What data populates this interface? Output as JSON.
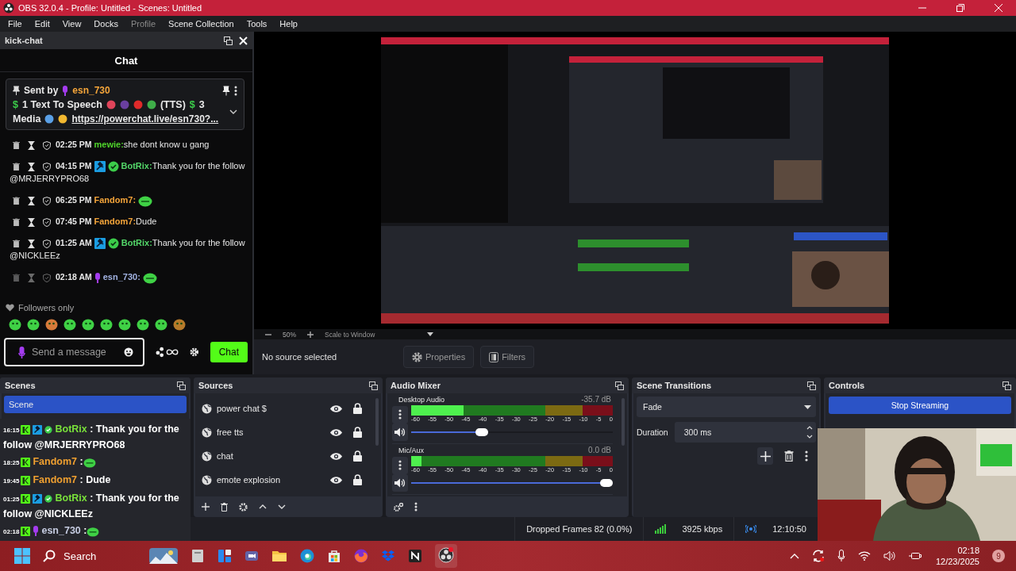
{
  "window": {
    "title": "OBS 32.0.4 - Profile: Untitled - Scenes: Untitled"
  },
  "menu": [
    {
      "label": "File",
      "disabled": false
    },
    {
      "label": "Edit",
      "disabled": false
    },
    {
      "label": "View",
      "disabled": false
    },
    {
      "label": "Docks",
      "disabled": false
    },
    {
      "label": "Profile",
      "disabled": true
    },
    {
      "label": "Scene Collection",
      "disabled": false
    },
    {
      "label": "Tools",
      "disabled": false
    },
    {
      "label": "Help",
      "disabled": false
    }
  ],
  "chat_dock": {
    "title": "kick-chat",
    "header": "Chat",
    "pinned": {
      "prefix": "Sent by",
      "user": "esn_730",
      "parts": [
        {
          "kind": "dollar",
          "text": "$"
        },
        {
          "kind": "text",
          "text": "1 Text To Speech"
        },
        {
          "kind": "emoji",
          "color": "#e0445a"
        },
        {
          "kind": "emoji",
          "color": "#6a3fa0"
        },
        {
          "kind": "emoji",
          "color": "#e02a2a"
        },
        {
          "kind": "emoji",
          "color": "#3fae49"
        },
        {
          "kind": "text",
          "text": "(TTS)"
        },
        {
          "kind": "dollar",
          "text": "$"
        },
        {
          "kind": "text",
          "text": "3"
        },
        {
          "kind": "text",
          "text": "Media"
        },
        {
          "kind": "emoji",
          "color": "#5aa0e6"
        },
        {
          "kind": "emoji",
          "color": "#f2b830"
        },
        {
          "kind": "link",
          "text": "https://powerchat.live/esn730?..."
        }
      ]
    },
    "messages": [
      {
        "kind": "user",
        "time": "02:25 PM",
        "user": "mewie:",
        "color": "#4fd62b",
        "text": "she dont know u gang",
        "emote": false
      },
      {
        "kind": "bot",
        "time": "04:15 PM",
        "user": "BotRix:",
        "color": "#53d769",
        "text": "Thank you for the follow",
        "mention": "@MRJERRYPRO68",
        "emote": false
      },
      {
        "kind": "user",
        "time": "06:25 PM",
        "user": "Fandom7:",
        "color": "#f5a53a",
        "emote": true
      },
      {
        "kind": "user",
        "time": "07:45 PM",
        "user": "Fandom7:",
        "color": "#f5a53a",
        "text": "Dude",
        "emote": false
      },
      {
        "kind": "bot",
        "time": "01:25 AM",
        "user": "BotRix:",
        "color": "#53d769",
        "text": "Thank you for the follow",
        "mention": "@NICKLEEz",
        "emote": false
      },
      {
        "kind": "self",
        "time": "02:18 AM",
        "user": "esn_730:",
        "color": "#a2b3e3",
        "emote": true
      }
    ],
    "mode": "Followers only",
    "input": {
      "placeholder": "Send a message"
    },
    "send": "Chat"
  },
  "preview": {
    "kind": "picture",
    "zoom": "50%",
    "scale_mode": "Scale to Window"
  },
  "source_bar": {
    "status": "No source selected",
    "buttons": [
      {
        "kind": "properties",
        "label": "Properties"
      },
      {
        "kind": "filters",
        "label": "Filters"
      }
    ]
  },
  "scenes": {
    "title": "Scenes",
    "items": [
      {
        "label": "Scene",
        "selected": true
      }
    ]
  },
  "sources": {
    "title": "Sources",
    "items": [
      {
        "label": "power chat $",
        "visible": true,
        "locked": true
      },
      {
        "label": "free tts",
        "visible": true,
        "locked": true
      },
      {
        "label": "chat",
        "visible": true,
        "locked": true
      },
      {
        "label": "emote explosion",
        "visible": true,
        "locked": true
      }
    ]
  },
  "audio_mixer": {
    "title": "Audio Mixer",
    "channels": [
      {
        "name": "Desktop Audio",
        "reading": "-35.7 dB",
        "meter": {
          "level": 0.26
        },
        "volume": {
          "level": 0.34
        },
        "ticks": [
          "-60",
          "-55",
          "-50",
          "-45",
          "-40",
          "-35",
          "-30",
          "-25",
          "-20",
          "-15",
          "-10",
          "-5",
          "0"
        ]
      },
      {
        "name": "Mic/Aux",
        "reading": "0.0 dB",
        "meter": {
          "level": 0.05
        },
        "volume": {
          "level": 1
        },
        "ticks": [
          "-60",
          "-55",
          "-50",
          "-45",
          "-40",
          "-35",
          "-30",
          "-25",
          "-20",
          "-15",
          "-10",
          "-5",
          "0"
        ]
      }
    ]
  },
  "transitions": {
    "title": "Scene Transitions",
    "transition": "Fade",
    "duration_label": "Duration",
    "duration": "300 ms"
  },
  "controls": {
    "title": "Controls",
    "buttons": [
      {
        "label": "Stop Streaming",
        "selected": true
      }
    ]
  },
  "overlay_chat": [
    {
      "kind": "bot",
      "time": "16:15",
      "user": "BotRix",
      "color": "#79e03a",
      "text": ": Thank you for the",
      "line_2": "follow @MRJERRYPRO68",
      "emote": false
    },
    {
      "kind": "user",
      "time": "18:25",
      "user": "Fandom7",
      "color": "#f0a030",
      "text": ":",
      "emote": true
    },
    {
      "kind": "user",
      "time": "19:45",
      "user": "Fandom7",
      "color": "#f0a030",
      "text": ": Dude",
      "emote": false
    },
    {
      "kind": "bot",
      "time": "01:25",
      "user": "BotRix",
      "color": "#79e03a",
      "text": ": Thank you for the",
      "line_2": "follow @NICKLEEz",
      "emote": false
    },
    {
      "kind": "self",
      "time": "02:18",
      "user": "esn_730",
      "color": "#c5cbe0",
      "text": ":",
      "emote": true
    }
  ],
  "status_bar": {
    "dropped": "Dropped Frames 82 (0.0%)",
    "bitrate": "3925 kbps",
    "time": "12:10:50"
  },
  "taskbar": {
    "search": "Search",
    "time": "02:18",
    "date": "12/23/2025",
    "notifications": "9"
  }
}
